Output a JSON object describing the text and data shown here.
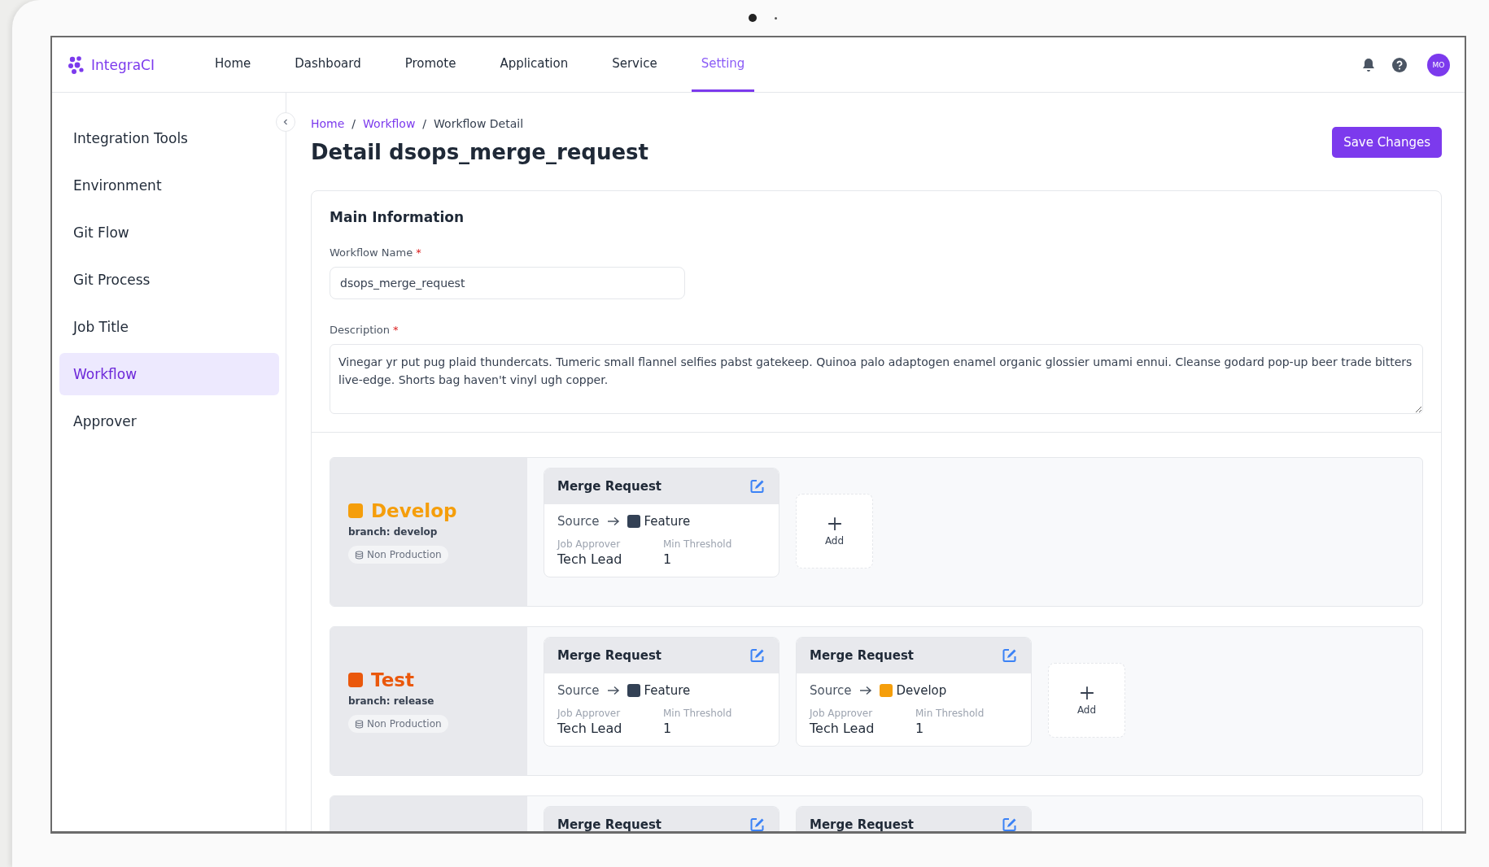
{
  "app": {
    "name": "IntegraCI",
    "avatar": "MO"
  },
  "nav": [
    {
      "label": "Home",
      "selected": false
    },
    {
      "label": "Dashboard",
      "selected": false
    },
    {
      "label": "Promote",
      "selected": false
    },
    {
      "label": "Application",
      "selected": false
    },
    {
      "label": "Service",
      "selected": false
    },
    {
      "label": "Setting",
      "selected": true
    }
  ],
  "sidebar": {
    "items": [
      {
        "label": "Integration Tools",
        "selected": false
      },
      {
        "label": "Environment",
        "selected": false
      },
      {
        "label": "Git Flow",
        "selected": false
      },
      {
        "label": "Git Process",
        "selected": false
      },
      {
        "label": "Job Title",
        "selected": false
      },
      {
        "label": "Workflow",
        "selected": true
      },
      {
        "label": "Approver",
        "selected": false
      }
    ]
  },
  "breadcrumb": [
    {
      "label": "Home",
      "kind": "link"
    },
    {
      "label": "Workflow",
      "kind": "link"
    },
    {
      "label": "Workflow Detail",
      "kind": "current"
    }
  ],
  "breadcrumb_separator": "/",
  "page_title": "Detail dsops_merge_request",
  "save_button": "Save Changes",
  "main_information": {
    "title": "Main Information",
    "fields": [
      {
        "kind": "input",
        "label": "Workflow Name",
        "required_mark": "*",
        "value": "dsops_merge_request"
      },
      {
        "kind": "textarea",
        "label": "Description",
        "required_mark": "*",
        "value": "Vinegar yr put pug plaid thundercats. Tumeric small flannel selfies pabst gatekeep. Quinoa palo adaptogen enamel organic glossier umami ennui. Cleanse godard pop-up beer trade bitters live-edge. Shorts bag haven't vinyl ugh copper."
      }
    ]
  },
  "stages": [
    {
      "name": "Develop",
      "color": "#f59e0b",
      "branch": "branch: develop",
      "environment": "Non Production",
      "add": "Add",
      "cards": [
        {
          "title": "Merge Request",
          "source": "Source",
          "target": {
            "name": "Feature",
            "color": "#334155"
          },
          "approver_label": "Job Approver",
          "approver": "Tech Lead",
          "threshold_label": "Min Threshold",
          "threshold": "1"
        }
      ]
    },
    {
      "name": "Test",
      "color": "#ea580c",
      "branch": "branch: release",
      "environment": "Non Production",
      "add": "Add",
      "cards": [
        {
          "title": "Merge Request",
          "source": "Source",
          "target": {
            "name": "Feature",
            "color": "#334155"
          },
          "approver_label": "Job Approver",
          "approver": "Tech Lead",
          "threshold_label": "Min Threshold",
          "threshold": "1"
        },
        {
          "title": "Merge Request",
          "source": "Source",
          "target": {
            "name": "Develop",
            "color": "#f59e0b"
          },
          "approver_label": "Job Approver",
          "approver": "Tech Lead",
          "threshold_label": "Min Threshold",
          "threshold": "1"
        }
      ]
    },
    {
      "cards": [
        {
          "title": "Merge Request"
        },
        {
          "title": "Merge Request"
        }
      ]
    }
  ]
}
